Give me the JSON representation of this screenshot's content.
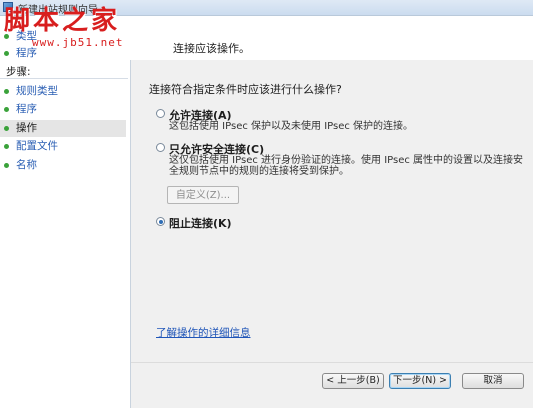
{
  "window": {
    "title": "新建出站规则向导"
  },
  "watermark": {
    "main": "脚本之家",
    "sub": "www.jb51.net"
  },
  "header": {
    "text": "连接应该操作。"
  },
  "sidebar": {
    "top_items": [
      {
        "label": "类型"
      },
      {
        "label": "程序"
      }
    ],
    "steps_label": "步骤:",
    "items": [
      {
        "label": "规则类型"
      },
      {
        "label": "程序"
      },
      {
        "label": "操作"
      },
      {
        "label": "配置文件"
      },
      {
        "label": "名称"
      }
    ],
    "active_index": 2
  },
  "main": {
    "question": "连接符合指定条件时应该进行什么操作?",
    "options": [
      {
        "label": "允许连接(A)",
        "desc": "这包括使用 IPsec 保护以及未使用 IPsec 保护的连接。",
        "selected": false
      },
      {
        "label": "只允许安全连接(C)",
        "desc1": "这仅包括使用 IPsec 进行身份验证的连接。使用 IPsec 属性中的设置以及连接安",
        "desc2": "全规则节点中的规则的连接将受到保护。",
        "selected": false
      },
      {
        "label": "阻止连接(K)",
        "selected": true
      }
    ],
    "custom_button": "自定义(Z)...",
    "more_link": "了解操作的详细信息"
  },
  "footer": {
    "back": "< 上一步(B)",
    "next": "下一步(N) >",
    "cancel": "取消"
  }
}
